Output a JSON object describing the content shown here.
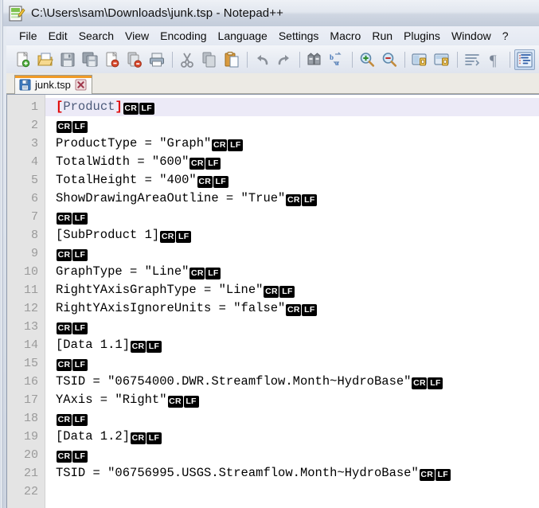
{
  "window": {
    "title": "C:\\Users\\sam\\Downloads\\junk.tsp - Notepad++",
    "app_icon": "notepad-plus-plus-icon"
  },
  "menubar": {
    "items": [
      {
        "label": "File"
      },
      {
        "label": "Edit"
      },
      {
        "label": "Search"
      },
      {
        "label": "View"
      },
      {
        "label": "Encoding"
      },
      {
        "label": "Language"
      },
      {
        "label": "Settings"
      },
      {
        "label": "Macro"
      },
      {
        "label": "Run"
      },
      {
        "label": "Plugins"
      },
      {
        "label": "Window"
      },
      {
        "label": "?"
      }
    ]
  },
  "toolbar": {
    "buttons": [
      {
        "icon": "new-file-icon",
        "pressed": false
      },
      {
        "icon": "open-file-icon",
        "pressed": false
      },
      {
        "icon": "save-icon",
        "pressed": false
      },
      {
        "icon": "save-all-icon",
        "pressed": false
      },
      {
        "icon": "close-file-icon",
        "pressed": false
      },
      {
        "icon": "close-all-files-icon",
        "pressed": false
      },
      {
        "icon": "print-icon",
        "pressed": false
      },
      {
        "separator": true
      },
      {
        "icon": "cut-icon",
        "pressed": false
      },
      {
        "icon": "copy-icon",
        "pressed": false
      },
      {
        "icon": "paste-icon",
        "pressed": false
      },
      {
        "separator": true
      },
      {
        "icon": "undo-icon",
        "pressed": false
      },
      {
        "icon": "redo-icon",
        "pressed": false
      },
      {
        "separator": true
      },
      {
        "icon": "find-icon",
        "pressed": false
      },
      {
        "icon": "replace-icon",
        "pressed": false
      },
      {
        "separator": true
      },
      {
        "icon": "zoom-in-icon",
        "pressed": false
      },
      {
        "icon": "zoom-out-icon",
        "pressed": false
      },
      {
        "separator": true
      },
      {
        "icon": "sync-vertical-scroll-icon",
        "pressed": false
      },
      {
        "icon": "sync-horizontal-scroll-icon",
        "pressed": false
      },
      {
        "separator": true
      },
      {
        "icon": "word-wrap-icon",
        "pressed": false
      },
      {
        "icon": "show-all-characters-icon",
        "pressed": false
      },
      {
        "separator": true
      },
      {
        "icon": "indent-guideline-icon",
        "pressed": true
      },
      {
        "icon": "user-defined-dialog-icon",
        "pressed": false
      },
      {
        "icon": "document-map-icon",
        "pressed": false
      }
    ]
  },
  "tabs": [
    {
      "label": "junk.tsp",
      "icon": "saved-document-icon",
      "close_icon": "close-icon",
      "active": true
    }
  ],
  "editor": {
    "current_line": 1,
    "colors": {
      "bracket": "#e00000",
      "section_text": "#4c5a7a",
      "current_line_bg": "#eceaf7",
      "gutter_bg": "#e4e4e4",
      "line_number_fg": "#9a9a9a",
      "eol_badge_bg": "#000000"
    },
    "eol_marker": {
      "cr": "CR",
      "lf": "LF"
    },
    "lines": [
      {
        "number": "1",
        "segments": [
          {
            "t": "[",
            "c": "bracket"
          },
          {
            "t": "Product",
            "c": "section"
          },
          {
            "t": "]",
            "c": "bracket"
          }
        ],
        "eol": true
      },
      {
        "number": "2",
        "segments": [],
        "eol": true
      },
      {
        "number": "3",
        "segments": [
          {
            "t": "ProductType = \"Graph\"",
            "c": "plain"
          }
        ],
        "eol": true
      },
      {
        "number": "4",
        "segments": [
          {
            "t": "TotalWidth = \"600\"",
            "c": "plain"
          }
        ],
        "eol": true
      },
      {
        "number": "5",
        "segments": [
          {
            "t": "TotalHeight = \"400\"",
            "c": "plain"
          }
        ],
        "eol": true
      },
      {
        "number": "6",
        "segments": [
          {
            "t": "ShowDrawingAreaOutline = \"True\"",
            "c": "plain"
          }
        ],
        "eol": true
      },
      {
        "number": "7",
        "segments": [],
        "eol": true
      },
      {
        "number": "8",
        "segments": [
          {
            "t": "[SubProduct 1]",
            "c": "plain"
          }
        ],
        "eol": true
      },
      {
        "number": "9",
        "segments": [],
        "eol": true
      },
      {
        "number": "10",
        "segments": [
          {
            "t": "GraphType = \"Line\"",
            "c": "plain"
          }
        ],
        "eol": true
      },
      {
        "number": "11",
        "segments": [
          {
            "t": "RightYAxisGraphType = \"Line\"",
            "c": "plain"
          }
        ],
        "eol": true
      },
      {
        "number": "12",
        "segments": [
          {
            "t": "RightYAxisIgnoreUnits = \"false\"",
            "c": "plain"
          }
        ],
        "eol": true
      },
      {
        "number": "13",
        "segments": [],
        "eol": true
      },
      {
        "number": "14",
        "segments": [
          {
            "t": "[Data 1.1]",
            "c": "plain"
          }
        ],
        "eol": true
      },
      {
        "number": "15",
        "segments": [],
        "eol": true
      },
      {
        "number": "16",
        "segments": [
          {
            "t": "TSID = \"06754000.DWR.Streamflow.Month~HydroBase\"",
            "c": "plain"
          }
        ],
        "eol": true
      },
      {
        "number": "17",
        "segments": [
          {
            "t": "YAxis = \"Right\"",
            "c": "plain"
          }
        ],
        "eol": true
      },
      {
        "number": "18",
        "segments": [],
        "eol": true
      },
      {
        "number": "19",
        "segments": [
          {
            "t": "[Data 1.2]",
            "c": "plain"
          }
        ],
        "eol": true
      },
      {
        "number": "20",
        "segments": [],
        "eol": true
      },
      {
        "number": "21",
        "segments": [
          {
            "t": "TSID = \"06756995.USGS.Streamflow.Month~HydroBase\"",
            "c": "plain"
          }
        ],
        "eol": true
      },
      {
        "number": "22",
        "segments": [],
        "eol": false
      }
    ]
  }
}
